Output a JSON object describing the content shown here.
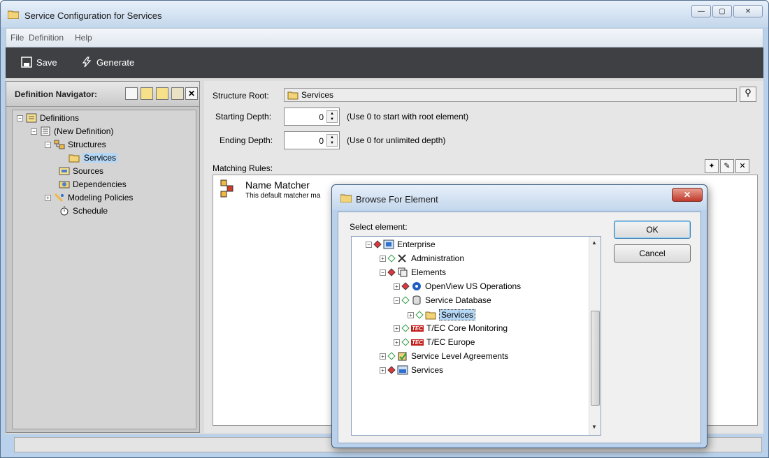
{
  "window": {
    "title": "Service Configuration for Services",
    "min_label": "—",
    "max_label": "▢",
    "close_label": "✕"
  },
  "menu": {
    "items": [
      "File",
      "Definition",
      "Help"
    ]
  },
  "toolbar": {
    "save_label": "Save",
    "generate_label": "Generate"
  },
  "navigator": {
    "title": "Definition Navigator:",
    "tree": {
      "definitions": "Definitions",
      "new_definition": "(New Definition)",
      "structures": "Structures",
      "services": "Services",
      "sources": "Sources",
      "dependencies": "Dependencies",
      "modeling_policies": "Modeling Policies",
      "schedule": "Schedule"
    }
  },
  "config": {
    "structure_root_label": "Structure Root:",
    "structure_root_value": "Services",
    "starting_depth_label": "Starting Depth:",
    "starting_depth_value": "0",
    "starting_depth_hint": "(Use 0 to start with root element)",
    "ending_depth_label": "Ending Depth:",
    "ending_depth_value": "0",
    "ending_depth_hint": "(Use 0 for unlimited depth)",
    "matching_rules_label": "Matching Rules:",
    "rule_name": "Name Matcher",
    "rule_desc": "This default matcher ma"
  },
  "dialog": {
    "title": "Browse For Element",
    "select_label": "Select element:",
    "ok_label": "OK",
    "cancel_label": "Cancel",
    "tree": {
      "enterprise": "Enterprise",
      "administration": "Administration",
      "elements": "Elements",
      "openview": "OpenView US Operations",
      "service_db": "Service Database",
      "services_sel": "Services",
      "tec_core": "T/EC Core Monitoring",
      "tec_europe": "T/EC Europe",
      "sla": "Service Level Agreements",
      "services": "Services"
    },
    "tec_badge": "TEC"
  },
  "colors": {
    "toolbar_bg": "#3e4043",
    "selection": "#b4d7f5",
    "status_red": "#e0353b",
    "status_green": "#2f9e44"
  }
}
